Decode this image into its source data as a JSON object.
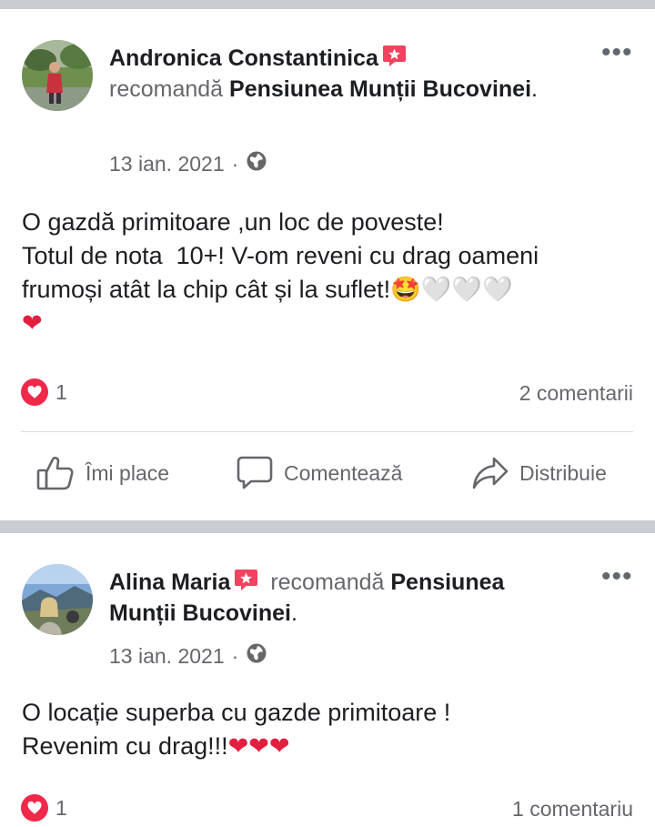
{
  "posts": [
    {
      "author": "Andronica Constantinica",
      "verb": "recomandă",
      "page": "Pensiunea Munții Bucovinei",
      "period": ".",
      "date": "13 ian. 2021",
      "sep": "·",
      "lines": [
        "O gazdă primitoare ,un loc de poveste!",
        "Totul de nota  10+! V-om reveni cu drag oameni",
        "frumoși atât la chip cât și la suflet!"
      ],
      "emoji_star": "🤩",
      "emoji_white": "🤍🤍🤍",
      "emoji_red": "❤",
      "reaction_count": "1",
      "comments": "2 comentarii"
    },
    {
      "author": "Alina Maria",
      "verb": "recomandă",
      "page_line1": "Pensiunea",
      "page_line2": "Munții Bucovinei",
      "period": ".",
      "date": "13 ian. 2021",
      "sep": "·",
      "lines": [
        "O locație superba cu gazde primitoare !",
        "Revenim cu drag!!!"
      ],
      "emoji_red": "❤❤❤",
      "reaction_count": "1",
      "comments": "1 comentariu"
    }
  ],
  "actions": {
    "like": "Îmi place",
    "comment": "Comentează",
    "share": "Distribuie"
  },
  "icons": {
    "more": "more-icon",
    "globe": "globe-icon",
    "recommend_badge": "recommend-badge-icon",
    "like": "thumbs-up-icon",
    "comment": "comment-icon",
    "share": "share-icon",
    "reaction": "love-reaction-icon"
  },
  "colors": {
    "reaction": "#f0284a",
    "badge": "#f3425f",
    "separator": "#c9ccd1",
    "muted": "#65676b"
  },
  "more_glyph": "•••"
}
